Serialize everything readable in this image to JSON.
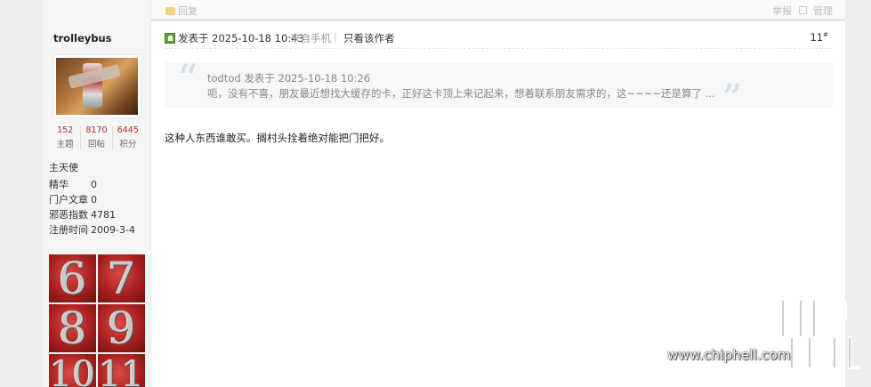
{
  "prev_post_actions": {
    "reply_label": "回复",
    "report_label": "举报",
    "manage_label": "管理"
  },
  "author": {
    "username": "trolleybus",
    "stats": [
      {
        "value": "152",
        "label": "主题"
      },
      {
        "value": "8170",
        "label": "回帖"
      },
      {
        "value": "6445",
        "label": "积分"
      }
    ],
    "group": "主天使",
    "info": [
      {
        "key": "精华",
        "value": "0"
      },
      {
        "key": "门户文章",
        "value": "0"
      },
      {
        "key": "邪恶指数",
        "value": "4781"
      },
      {
        "key": "注册时间",
        "value": "2009-3-4"
      }
    ],
    "medals": [
      "6",
      "7",
      "8",
      "9",
      "10",
      "11"
    ]
  },
  "post": {
    "time": "发表于 2025-10-18 10:43",
    "source": "来自手机",
    "divider": "|",
    "only_author": "只看该作者",
    "floor_number": "11",
    "floor_mark": "#",
    "quote": {
      "author_line": "todtod 发表于 2025-10-18 10:26",
      "text": "呃，没有不喜，朋友最近想找大缓存的卡，正好这卡顶上来记起来，想着联系朋友需求的，这~~~~还是算了 ..."
    },
    "body": "这种人东西谁敢买。搁村头拴着绝对能把门把好。"
  },
  "watermark": {
    "site": "www.chiphell.com"
  },
  "colors": {
    "stat_number": "#b0282c",
    "online_icon": "#58a42d",
    "quote_mark": "#cfe0ef",
    "medal_red": "#a8201e"
  }
}
